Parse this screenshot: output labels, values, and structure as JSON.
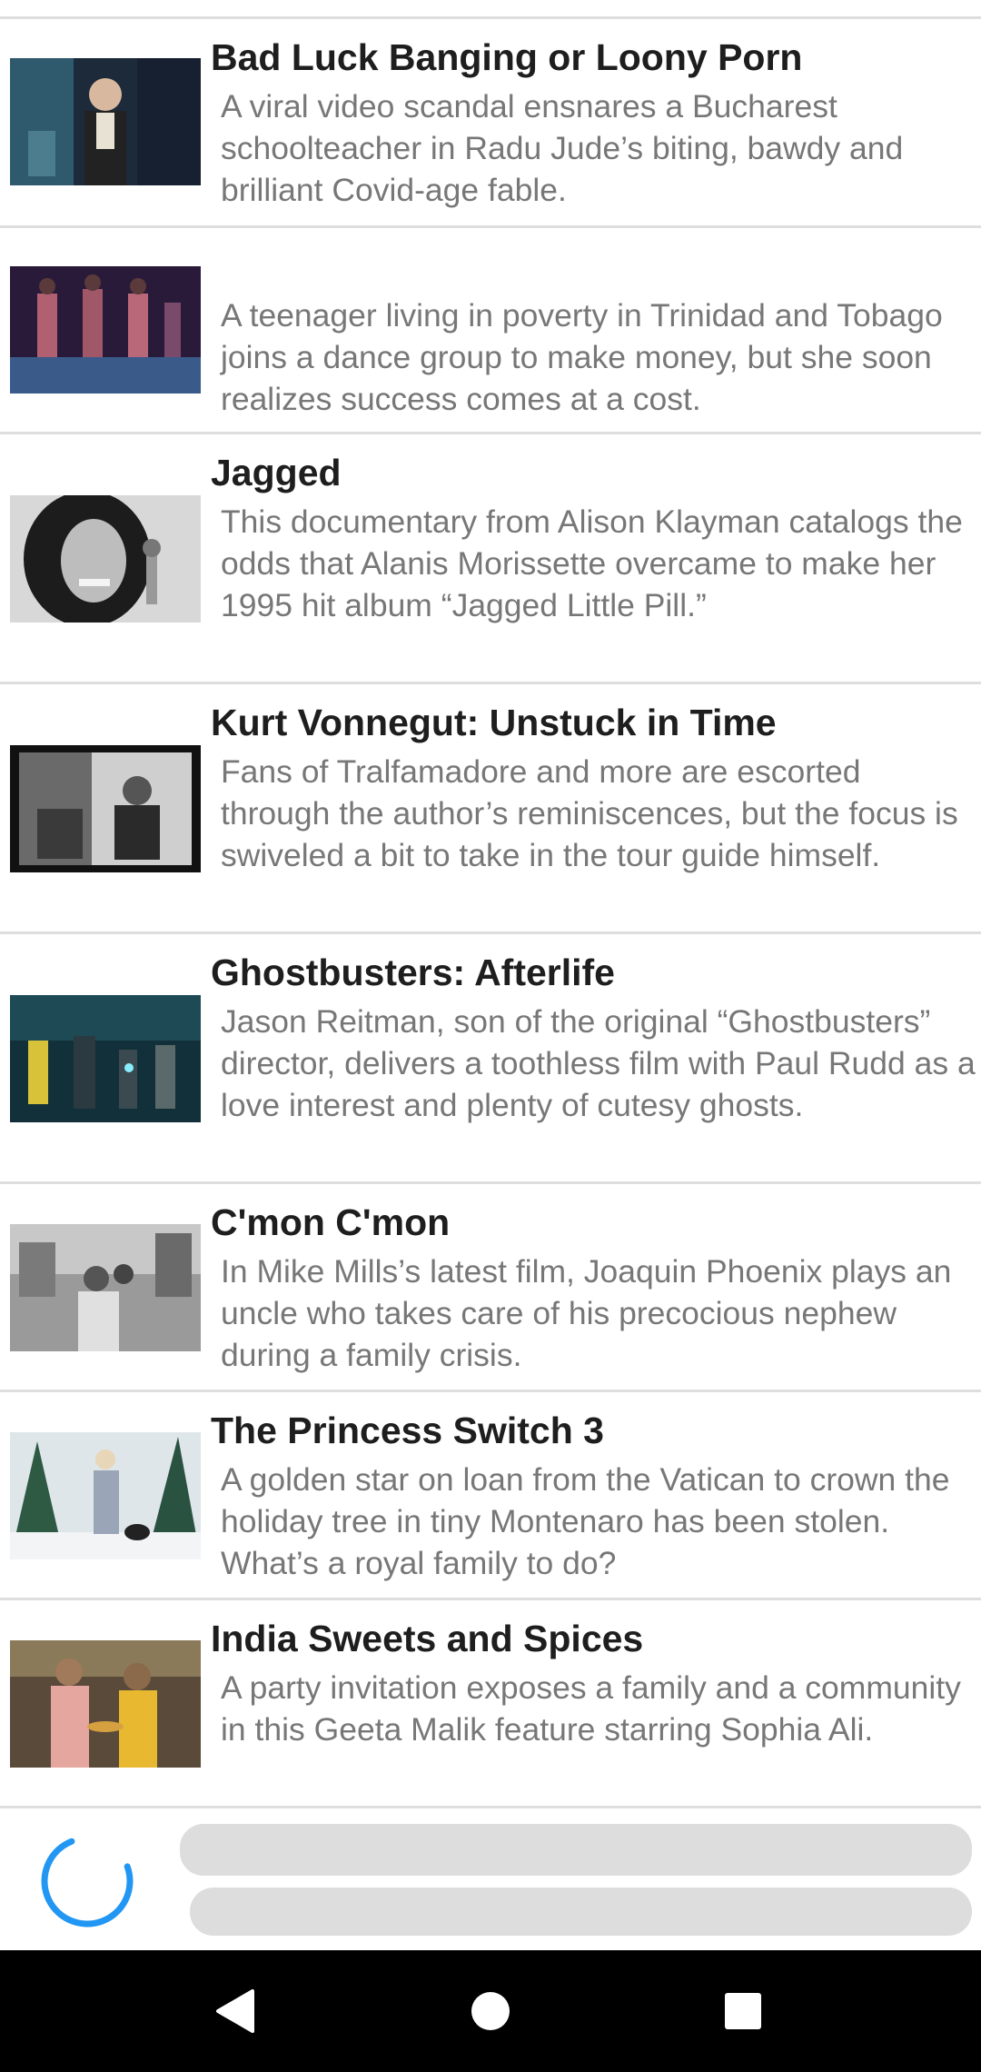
{
  "movies": [
    {
      "title": "Bad Luck Banging or Loony Porn",
      "description": "A viral video scandal ensnares a Bucharest schoolteacher in Radu Jude’s biting, bawdy and brilliant Covid-age fable."
    },
    {
      "title": "",
      "description": "A teenager living in poverty in Trinidad and Tobago joins a dance group to make money, but she soon realizes success comes at a cost."
    },
    {
      "title": "Jagged",
      "description": "This documentary from Alison Klayman catalogs the odds that Alanis Morissette overcame to make her 1995 hit album “Jagged Little Pill.”"
    },
    {
      "title": "Kurt Vonnegut: Unstuck in Time",
      "description": "Fans of Tralfamadore and more are escorted through the author’s reminiscences, but the focus is swiveled a bit to take in the tour guide himself."
    },
    {
      "title": "Ghostbusters: Afterlife",
      "description": "Jason Reitman, son of the original “Ghostbusters” director, delivers a toothless film with Paul Rudd as a love interest and plenty of cutesy ghosts."
    },
    {
      "title": "C'mon C'mon",
      "description": "In Mike Mills’s latest film, Joaquin Phoenix plays an uncle who takes care of his precocious nephew during a family crisis."
    },
    {
      "title": "The Princess Switch 3",
      "description": "A golden star on loan from the Vatican to crown the holiday tree in tiny Montenaro has been stolen. What’s a royal family to do?"
    },
    {
      "title": "India Sweets and Spices",
      "description": "A party invitation exposes a family and a community in this Geeta Malik feature starring Sophia Ali."
    }
  ],
  "loading": {
    "spinner_icon": "loading-spinner-icon",
    "spinner_color": "#2196f3"
  },
  "navbar": {
    "back_icon": "back-triangle-icon",
    "home_icon": "home-circle-icon",
    "recents_icon": "recents-square-icon"
  }
}
